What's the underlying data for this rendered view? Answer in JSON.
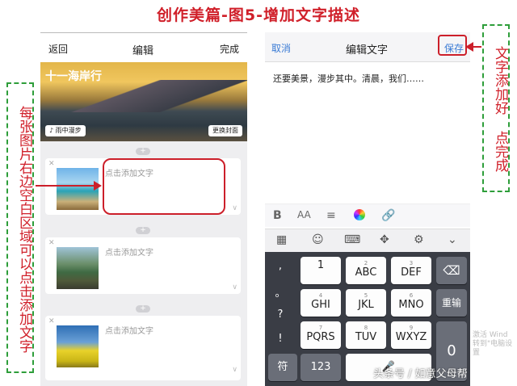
{
  "title": "创作美篇-图5-增加文字描述",
  "annotations": {
    "left": "每张图片右边空白区域可以点击添加文字",
    "right": "文字添加好 点完成"
  },
  "left_phone": {
    "back": "返回",
    "header": "编辑",
    "done": "完成",
    "hero_title": "十一海岸行",
    "music_btn": "♪ 雨中漫步",
    "change_cover": "更换封面",
    "plus": "+",
    "cards": [
      {
        "placeholder": "点击添加文字"
      },
      {
        "placeholder": "点击添加文字"
      },
      {
        "placeholder": "点击添加文字"
      }
    ]
  },
  "right_phone": {
    "cancel": "取消",
    "header": "编辑文字",
    "save": "保存",
    "content": "还要美景，漫步其中。清晨，我们……",
    "format_icons": [
      "bold-icon",
      "font-size-icon",
      "align-icon",
      "color-wheel-icon",
      "link-icon"
    ],
    "keyboard": {
      "symbols": [
        ",",
        "。",
        "?",
        "!"
      ],
      "row1": [
        {
          "sub": "",
          "main": "1"
        },
        {
          "sub": "2",
          "main": "ABC"
        },
        {
          "sub": "3",
          "main": "DEF"
        }
      ],
      "row2": [
        {
          "sub": "4",
          "main": "GHI"
        },
        {
          "sub": "5",
          "main": "JKL"
        },
        {
          "sub": "6",
          "main": "MNO"
        }
      ],
      "row3": [
        {
          "sub": "7",
          "main": "PQRS"
        },
        {
          "sub": "8",
          "main": "TUV"
        },
        {
          "sub": "9",
          "main": "WXYZ"
        }
      ],
      "backspace": "⌫",
      "reenter": "重输",
      "zero": "0",
      "sym_key": "符",
      "num_key": "123"
    }
  },
  "watermark": "头条号 / 如意父母帮",
  "activate": [
    "激活 Wind",
    "转到\"电脑设置"
  ],
  "colors": {
    "accent_red": "#cc1f2a",
    "accent_green": "#2e9e3a",
    "link_blue": "#3a7bd5"
  }
}
